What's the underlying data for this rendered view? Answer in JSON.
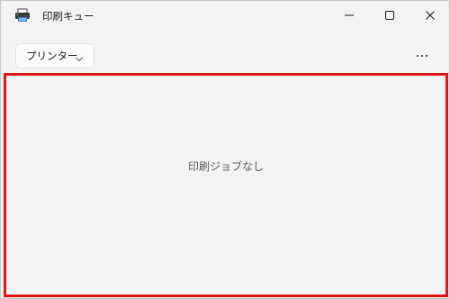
{
  "window": {
    "title": "印刷キュー"
  },
  "icons": {
    "app": "printer-icon",
    "minimize": "minimize-icon",
    "maximize": "maximize-icon",
    "close": "close-icon",
    "dropdown": "chevron-down-icon",
    "more": "more-horizontal-icon"
  },
  "toolbar": {
    "printer_dropdown_label": "プリンター"
  },
  "main": {
    "empty_message": "印刷ジョブなし"
  },
  "colors": {
    "background": "#f3f3f3",
    "highlight_border": "#e11515",
    "printer_icon_blue": "#2f7fd1",
    "printer_icon_green": "#5cb85c"
  }
}
